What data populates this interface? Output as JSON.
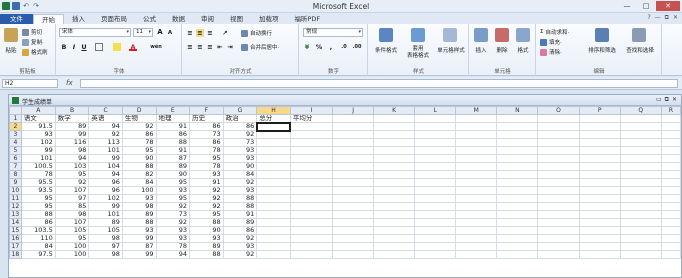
{
  "window": {
    "title": "Microsoft Excel",
    "controls": [
      "—",
      "□",
      "✕"
    ]
  },
  "quick_access": {
    "undo": "↶",
    "redo": "↷"
  },
  "ribbon_tabs": [
    "文件",
    "开始",
    "插入",
    "页面布局",
    "公式",
    "数据",
    "审阅",
    "视图",
    "加载项",
    "福昕PDF"
  ],
  "ribbon": {
    "clipboard": {
      "paste": "粘贴",
      "cut": "剪切",
      "copy": "复制·",
      "format_painter": "格式刷",
      "label": "剪贴板"
    },
    "font": {
      "name": "宋体",
      "size": "11",
      "grow": "A",
      "shrink": "A",
      "bold": "B",
      "italic": "I",
      "underline": "U",
      "phonetic": "wén",
      "label": "字体"
    },
    "alignment": {
      "wrap": "自动换行",
      "merge": "合并后居中·",
      "label": "对齐方式"
    },
    "number": {
      "format": "常规",
      "percent": "%",
      "comma": ",",
      "label": "数字"
    },
    "styles": {
      "conditional": "条件格式",
      "table": "套用\n表格格式",
      "cell_styles": "单元格样式",
      "label": "样式"
    },
    "cells": {
      "insert": "插入",
      "delete": "删除",
      "format": "格式",
      "label": "单元格"
    },
    "editing": {
      "autosum": "自动求和·",
      "fill": "填充·",
      "clear": "清除·",
      "sort": "排序和筛选",
      "find": "查找和选择",
      "label": "编辑"
    }
  },
  "formula_bar": {
    "name_box": "H2",
    "fx": "fx",
    "value": ""
  },
  "workbook": {
    "title": "学生成绩单",
    "controls": [
      "▭",
      "⧉",
      "✕"
    ],
    "columns": [
      "A",
      "B",
      "C",
      "D",
      "E",
      "F",
      "G",
      "H",
      "I",
      "J",
      "K",
      "L",
      "M",
      "N",
      "O",
      "P",
      "Q",
      "R"
    ],
    "selected_col": "H",
    "selected_row": 2,
    "rows": [
      [
        "1",
        "语文",
        "数学",
        "英语",
        "生物",
        "地理",
        "历史",
        "政治",
        "总分",
        "平均分"
      ],
      [
        "2",
        "91.5",
        "89",
        "94",
        "92",
        "91",
        "86",
        "86",
        "",
        ""
      ],
      [
        "3",
        "93",
        "99",
        "92",
        "86",
        "86",
        "73",
        "92",
        "",
        ""
      ],
      [
        "4",
        "102",
        "116",
        "113",
        "78",
        "88",
        "86",
        "73",
        "",
        ""
      ],
      [
        "5",
        "99",
        "98",
        "101",
        "95",
        "91",
        "78",
        "93",
        "",
        ""
      ],
      [
        "6",
        "101",
        "94",
        "99",
        "90",
        "87",
        "95",
        "93",
        "",
        ""
      ],
      [
        "7",
        "100.5",
        "103",
        "104",
        "88",
        "89",
        "78",
        "90",
        "",
        ""
      ],
      [
        "8",
        "78",
        "95",
        "94",
        "82",
        "90",
        "93",
        "84",
        "",
        ""
      ],
      [
        "9",
        "95.5",
        "92",
        "96",
        "84",
        "95",
        "91",
        "92",
        "",
        ""
      ],
      [
        "10",
        "93.5",
        "107",
        "96",
        "100",
        "93",
        "92",
        "93",
        "",
        ""
      ],
      [
        "11",
        "95",
        "97",
        "102",
        "93",
        "95",
        "92",
        "88",
        "",
        ""
      ],
      [
        "12",
        "95",
        "85",
        "99",
        "98",
        "92",
        "92",
        "88",
        "",
        ""
      ],
      [
        "13",
        "88",
        "98",
        "101",
        "89",
        "73",
        "95",
        "91",
        "",
        ""
      ],
      [
        "14",
        "86",
        "107",
        "89",
        "88",
        "92",
        "88",
        "89",
        "",
        ""
      ],
      [
        "15",
        "103.5",
        "105",
        "105",
        "93",
        "93",
        "90",
        "86",
        "",
        ""
      ],
      [
        "16",
        "110",
        "95",
        "98",
        "99",
        "93",
        "93",
        "92",
        "",
        ""
      ],
      [
        "17",
        "84",
        "100",
        "97",
        "87",
        "78",
        "89",
        "93",
        "",
        ""
      ],
      [
        "18",
        "97.5",
        "100",
        "98",
        "99",
        "94",
        "88",
        "92",
        "",
        ""
      ]
    ]
  }
}
